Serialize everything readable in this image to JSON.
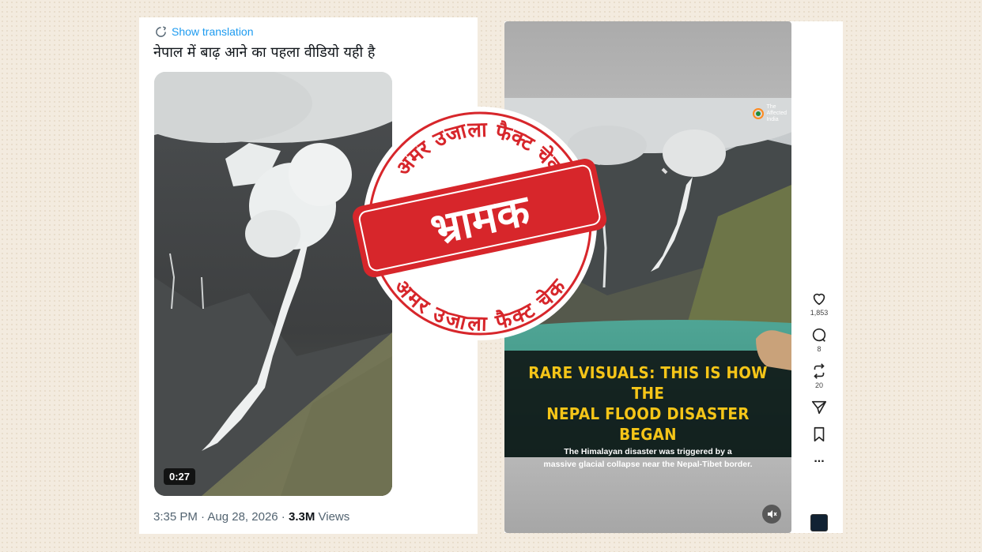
{
  "tweet": {
    "show_translation": "Show translation",
    "text": "नेपाल में बाढ़ आने का पहला वीडियो यही है",
    "video_duration": "0:27",
    "time": "3:35 PM",
    "separator": " · ",
    "date": "Aug 28, 2026",
    "views_count": "3.3M",
    "views_label": " Views"
  },
  "reel": {
    "headline_line1": "RARE VISUALS: THIS IS HOW THE",
    "headline_line2": "NEPAL FLOOD DISASTER BEGAN",
    "sub_line1": "The Himalayan disaster was triggered by a",
    "sub_line2": "massive glacial collapse near the Nepal-Tibet border.",
    "logo_text1": "The",
    "logo_text2": "Affected",
    "logo_text3": "India",
    "likes": "1,853",
    "comments": "8",
    "reposts": "20",
    "more": "..."
  },
  "stamp": {
    "top_arc": "अमर उजाला फैक्ट चेक",
    "bottom_arc": "अमर उजाला फैक्ट चेक",
    "verdict": "भ्रामक",
    "color": "#d7262b"
  },
  "colors": {
    "link_blue": "#1d9bf0",
    "caption_yellow": "#f5c518",
    "background": "#f3ebdf"
  }
}
